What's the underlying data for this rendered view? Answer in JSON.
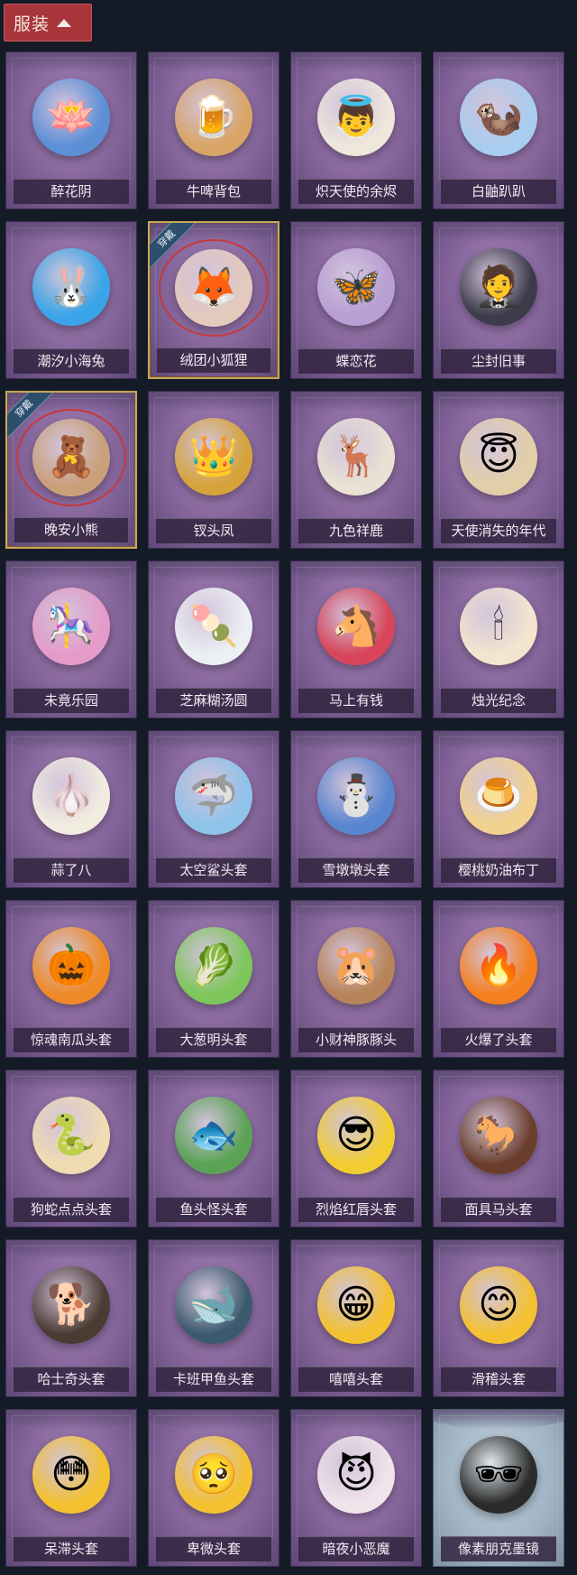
{
  "header": {
    "label": "服装"
  },
  "items": [
    {
      "label": "醉花阴",
      "icon": "🪷",
      "color": "#5c8fd6",
      "equipped": false
    },
    {
      "label": "牛啤背包",
      "icon": "🍺",
      "color": "#d9a567",
      "equipped": false
    },
    {
      "label": "炽天使的余烬",
      "icon": "👼",
      "color": "#efe6dc",
      "equipped": false
    },
    {
      "label": "白鼬趴趴",
      "icon": "🦦",
      "color": "#a9cdf0",
      "equipped": false
    },
    {
      "label": "潮汐小海兔",
      "icon": "🐰",
      "color": "#39a5e8",
      "equipped": false
    },
    {
      "label": "绒团小狐狸",
      "icon": "🦊",
      "color": "#e4c9bd",
      "equipped": true
    },
    {
      "label": "蝶恋花",
      "icon": "🦋",
      "color": "#b89fd4",
      "equipped": false
    },
    {
      "label": "尘封旧事",
      "icon": "🤵",
      "color": "#3b3b4a",
      "equipped": false
    },
    {
      "label": "晚安小熊",
      "icon": "🧸",
      "color": "#caa07a",
      "equipped": true
    },
    {
      "label": "钗头凤",
      "icon": "👑",
      "color": "#d6a33a",
      "equipped": false
    },
    {
      "label": "九色祥鹿",
      "icon": "🦌",
      "color": "#e9e1d3",
      "equipped": false
    },
    {
      "label": "天使消失的年代",
      "icon": "😇",
      "color": "#e2cfa8",
      "equipped": false
    },
    {
      "label": "未竟乐园",
      "icon": "🎠",
      "color": "#e59bc9",
      "equipped": false
    },
    {
      "label": "芝麻糊汤圆",
      "icon": "🍡",
      "color": "#ecf0f4",
      "equipped": false
    },
    {
      "label": "马上有钱",
      "icon": "🐴",
      "color": "#d8455a",
      "equipped": false
    },
    {
      "label": "烛光纪念",
      "icon": "🕯",
      "color": "#f3e6cf",
      "equipped": false
    },
    {
      "label": "蒜了八",
      "icon": "🧄",
      "color": "#f1ece0",
      "equipped": false
    },
    {
      "label": "太空鲨头套",
      "icon": "🦈",
      "color": "#8fc3ea",
      "equipped": false
    },
    {
      "label": "雪墩墩头套",
      "icon": "⛄",
      "color": "#5a86d0",
      "equipped": false
    },
    {
      "label": "樱桃奶油布丁",
      "icon": "🍮",
      "color": "#f2d28e",
      "equipped": false
    },
    {
      "label": "惊魂南瓜头套",
      "icon": "🎃",
      "color": "#ef8a26",
      "equipped": false
    },
    {
      "label": "大葱明头套",
      "icon": "🥬",
      "color": "#7ec65a",
      "equipped": false
    },
    {
      "label": "小财神豚豚头",
      "icon": "🐹",
      "color": "#b7845a",
      "equipped": false
    },
    {
      "label": "火爆了头套",
      "icon": "🔥",
      "color": "#f5801f",
      "equipped": false
    },
    {
      "label": "狗蛇点点头套",
      "icon": "🐍",
      "color": "#f1dcb2",
      "equipped": false
    },
    {
      "label": "鱼头怪头套",
      "icon": "🐟",
      "color": "#5aa255",
      "equipped": false
    },
    {
      "label": "烈焰红唇头套",
      "icon": "😎",
      "color": "#f2cd31",
      "equipped": false
    },
    {
      "label": "面具马头套",
      "icon": "🐎",
      "color": "#6a3e2c",
      "equipped": false
    },
    {
      "label": "哈士奇头套",
      "icon": "🐕",
      "color": "#4a3b33",
      "equipped": false
    },
    {
      "label": "卡班甲鱼头套",
      "icon": "🐋",
      "color": "#3c5a6e",
      "equipped": false
    },
    {
      "label": "嘻嘻头套",
      "icon": "😁",
      "color": "#f4c131",
      "equipped": false
    },
    {
      "label": "滑稽头套",
      "icon": "😊",
      "color": "#f4c131",
      "equipped": false
    },
    {
      "label": "呆滞头套",
      "icon": "😳",
      "color": "#f4c131",
      "equipped": false
    },
    {
      "label": "卑微头套",
      "icon": "🥺",
      "color": "#f4c131",
      "equipped": false
    },
    {
      "label": "暗夜小恶魔",
      "icon": "😈",
      "color": "#f0e3ea",
      "equipped": false
    },
    {
      "label": "像素朋克墨镜",
      "icon": "🕶",
      "color": "#2b2b2b",
      "equipped": false,
      "pixel": true
    }
  ],
  "equipped_badge": "穿戴"
}
